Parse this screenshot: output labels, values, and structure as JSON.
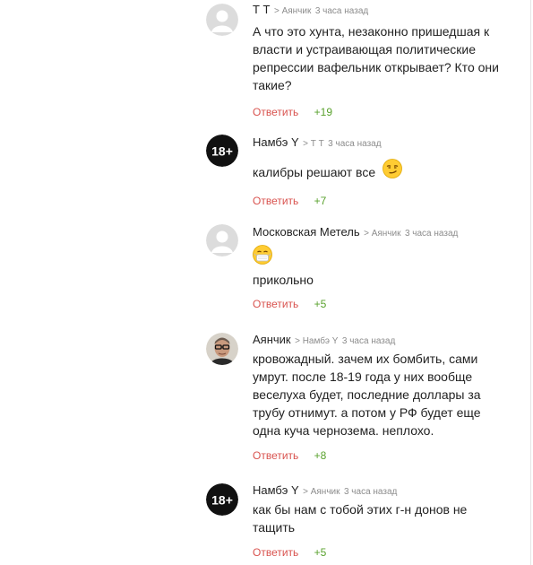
{
  "comments": [
    {
      "author": "Т Т",
      "reply_to": "> Аянчик",
      "time": "3 часа назад",
      "lines": [
        "А что это хунта, незаконно пришедшая к",
        "власти и устраивающая политические",
        "репрессии вафельник открывает? Кто они",
        "такие?"
      ],
      "reply_label": "Ответить",
      "score": "+19",
      "avatar": "default-avatar"
    },
    {
      "author": "Намбэ Y",
      "reply_to": "> Т Т",
      "time": "3 часа назад",
      "text": "калибры решают все",
      "emoji": "smirk-emoji",
      "reply_label": "Ответить",
      "score": "+7",
      "avatar": "18-plus-avatar",
      "avatar_text": "18+"
    },
    {
      "author": "Московская Метель",
      "reply_to": "> Аянчик",
      "time": "3 часа назад",
      "emoji": "mask-emoji",
      "text": "прикольно",
      "reply_label": "Ответить",
      "score": "+5",
      "avatar": "default-avatar"
    },
    {
      "author": "Аянчик",
      "reply_to": "> Намбэ Y",
      "time": "3 часа назад",
      "lines": [
        "кровожадный. зачем их бомбить, сами",
        "умрут. после 18-19 года у них вообще",
        "веселуха будет, последние доллары за",
        "трубу отнимут. а потом у РФ будет еще",
        "одна куча чернозема. неплохо."
      ],
      "reply_label": "Ответить",
      "score": "+8",
      "avatar": "photo-avatar"
    },
    {
      "author": "Намбэ Y",
      "reply_to": "> Аянчик",
      "time": "3 часа назад",
      "lines": [
        "как бы нам с тобой этих г-н донов не",
        "тащить"
      ],
      "reply_label": "Ответить",
      "score": "+5",
      "avatar": "18-plus-avatar",
      "avatar_text": "18+"
    }
  ]
}
